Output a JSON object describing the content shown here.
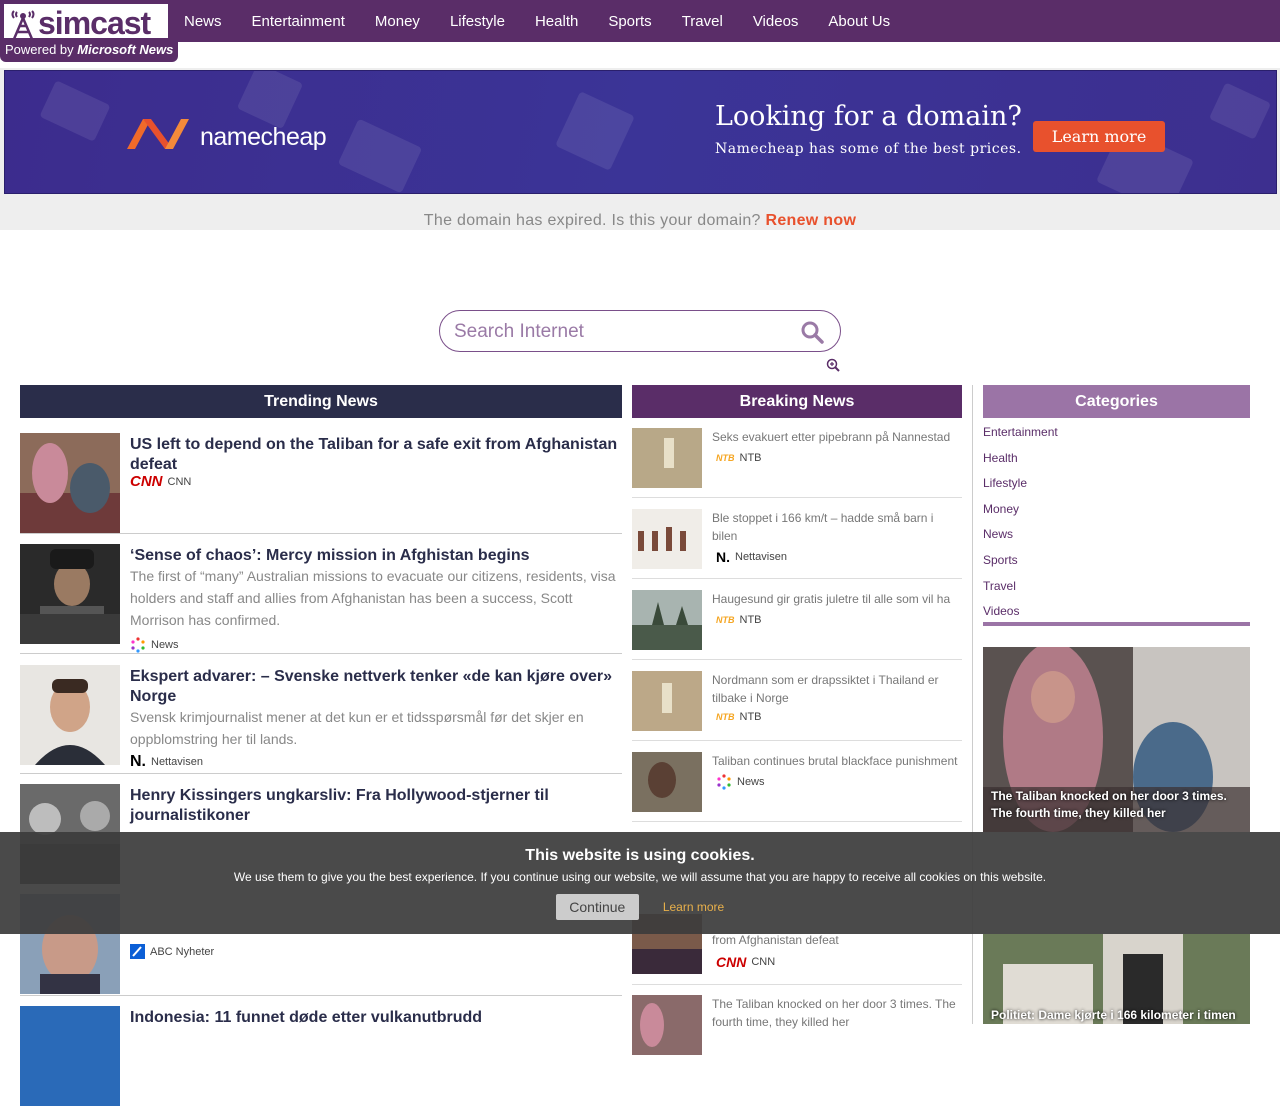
{
  "brand": {
    "name": "simcast",
    "powered_prefix": "Powered by",
    "powered_name": "Microsoft News"
  },
  "nav": [
    "News",
    "Entertainment",
    "Money",
    "Lifestyle",
    "Health",
    "Sports",
    "Travel",
    "Videos",
    "About Us"
  ],
  "ad": {
    "logo_text": "namecheap",
    "headline": "Looking for a domain?",
    "sub": "Namecheap has some of the best prices.",
    "button": "Learn more"
  },
  "expired": {
    "text": "The domain has expired. Is this your domain?",
    "link": "Renew now"
  },
  "search": {
    "placeholder": "Search Internet"
  },
  "sections": {
    "trending": "Trending News",
    "breaking": "Breaking News",
    "categories": "Categories"
  },
  "trending": [
    {
      "title": "US left to depend on the Taliban for a safe exit from Afghanistan defeat",
      "desc": "",
      "source": "CNN"
    },
    {
      "title": "‘Sense of chaos’: Mercy mission in Afghistan begins",
      "desc": "The first of “many” Australian missions to evacuate our citizens, residents, visa holders and staff and allies from Afghanistan has been a success, Scott Morrison has confirmed.",
      "source": "News"
    },
    {
      "title": "Ekspert advarer: – Svenske nettverk tenker «de kan kjøre over» Norge",
      "desc": "Svensk krimjournalist mener at det kun er et tidsspørsmål før det skjer en oppblomstring her til lands.",
      "source": "Nettavisen"
    },
    {
      "title": "Henry Kissingers ungkarsliv: Fra Hollywood-stjerner til journalistikoner",
      "desc": "",
      "source": ""
    },
    {
      "title": "",
      "desc": "",
      "source": "ABC Nyheter"
    },
    {
      "title": "Indonesia: 11 funnet døde etter vulkanutbrudd",
      "desc": "",
      "source": ""
    }
  ],
  "breaking": [
    {
      "title": "Seks evakuert etter pipebrann på Nannestad",
      "source": "NTB"
    },
    {
      "title": "Ble stoppet i 166 km/t – hadde små barn i bilen",
      "source": "Nettavisen"
    },
    {
      "title": "Haugesund gir gratis juletre til alle som vil ha",
      "source": "NTB"
    },
    {
      "title": "Nordmann som er drapssiktet i Thailand er tilbake i Norge",
      "source": "NTB"
    },
    {
      "title": "Taliban continues brutal blackface punishment",
      "source": "News"
    },
    {
      "title": "from Afghanistan defeat",
      "source": "CNN"
    },
    {
      "title": "The Taliban knocked on her door 3 times. The fourth time, they killed her",
      "source": ""
    }
  ],
  "categories": [
    "Entertainment",
    "Health",
    "Lifestyle",
    "Money",
    "News",
    "Sports",
    "Travel",
    "Videos"
  ],
  "features": [
    {
      "caption": "The Taliban knocked on her door 3 times. The fourth time, they killed her"
    },
    {
      "caption": "Politiet: Dame kjørte i 166 kilometer i timen"
    }
  ],
  "cookie": {
    "title": "This website is using cookies.",
    "message": "We use them to give you the best experience. If you continue using our website, we will assume that you are happy to receive all cookies on this website.",
    "continue": "Continue",
    "learn_more": "Learn more"
  },
  "colors": {
    "purple": "#5a2d68",
    "navy": "#2a2d4a",
    "lavender": "#9b74a6",
    "orange": "#e8512d"
  }
}
